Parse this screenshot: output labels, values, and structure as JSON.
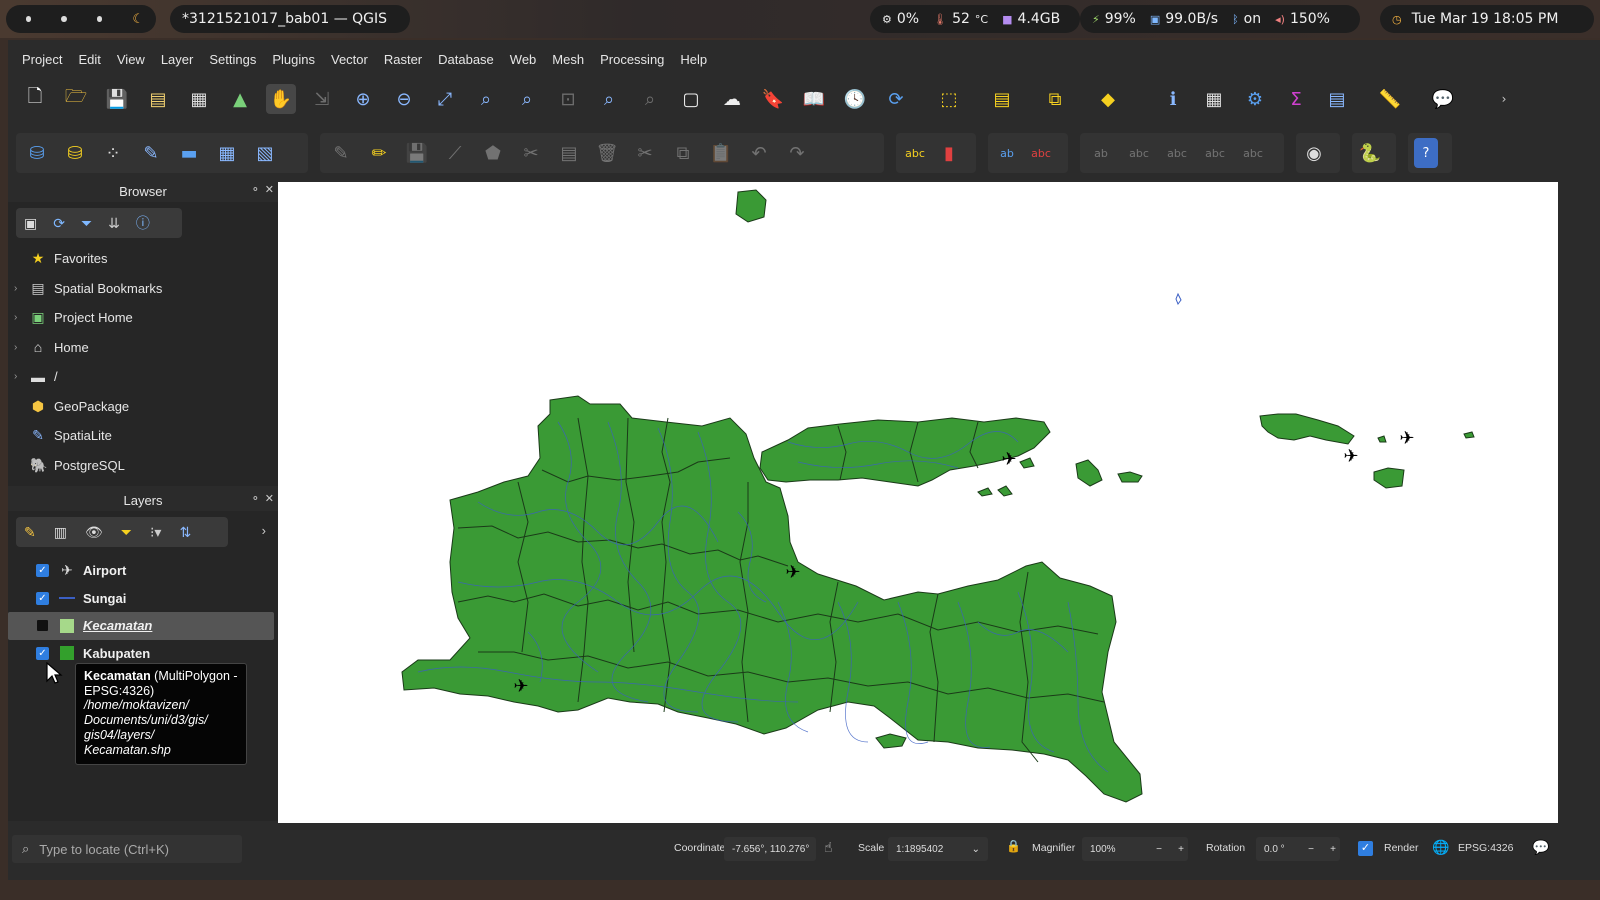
{
  "desktop": {
    "window_title": "*3121521017_bab01 — QGIS",
    "stats": {
      "cpu": "0%",
      "temp": "52",
      "temp_unit": "°C",
      "mem": "4.4GB",
      "battery": "99%",
      "net": "99.0B/s",
      "bluetooth": "on",
      "volume": "150%"
    },
    "clock": "Tue Mar 19 18:05 PM"
  },
  "menu": [
    "Project",
    "Edit",
    "View",
    "Layer",
    "Settings",
    "Plugins",
    "Vector",
    "Raster",
    "Database",
    "Web",
    "Mesh",
    "Processing",
    "Help"
  ],
  "browser": {
    "title": "Browser",
    "items": [
      {
        "label": "Favorites",
        "icon": "star-icon"
      },
      {
        "label": "Spatial Bookmarks",
        "icon": "bookmark-icon"
      },
      {
        "label": "Project Home",
        "icon": "project-home-icon"
      },
      {
        "label": "Home",
        "icon": "home-icon"
      },
      {
        "label": "/",
        "icon": "folder-icon"
      },
      {
        "label": "GeoPackage",
        "icon": "geopackage-icon"
      },
      {
        "label": "SpatiaLite",
        "icon": "spatialite-icon"
      },
      {
        "label": "PostgreSQL",
        "icon": "postgresql-icon"
      }
    ]
  },
  "layers": {
    "title": "Layers",
    "items": [
      {
        "name": "Airport",
        "checked": true,
        "symbol": "airplane-icon"
      },
      {
        "name": "Sungai",
        "checked": true,
        "symbol": "line-symbol",
        "color": "#3b5fc4"
      },
      {
        "name": "Kecamatan",
        "checked": false,
        "symbol": "fill-symbol",
        "color": "#a6d98a"
      },
      {
        "name": "Kabupaten",
        "checked": true,
        "symbol": "fill-symbol",
        "color": "#33a02c"
      }
    ]
  },
  "tooltip": {
    "name": "Kecamatan",
    "geom": " (MultiPolygon - EPSG:4326)",
    "path": "/home/moktavizen/ Documents/uni/d3/gis/ gis04/layers/ Kecamatan.shp"
  },
  "map": {
    "land_color": "#3a9a35",
    "river_color": "#3b5fc4"
  },
  "status": {
    "locator_placeholder": "Type to locate (Ctrl+K)",
    "coordinate_label": "Coordinate",
    "coordinate_value": "-7.656°, 110.276°",
    "scale_label": "Scale",
    "scale_value": "1:1895402",
    "magnifier_label": "Magnifier",
    "magnifier_value": "100%",
    "rotation_label": "Rotation",
    "rotation_value": "0.0 °",
    "render_label": "Render",
    "crs": "EPSG:4326"
  }
}
